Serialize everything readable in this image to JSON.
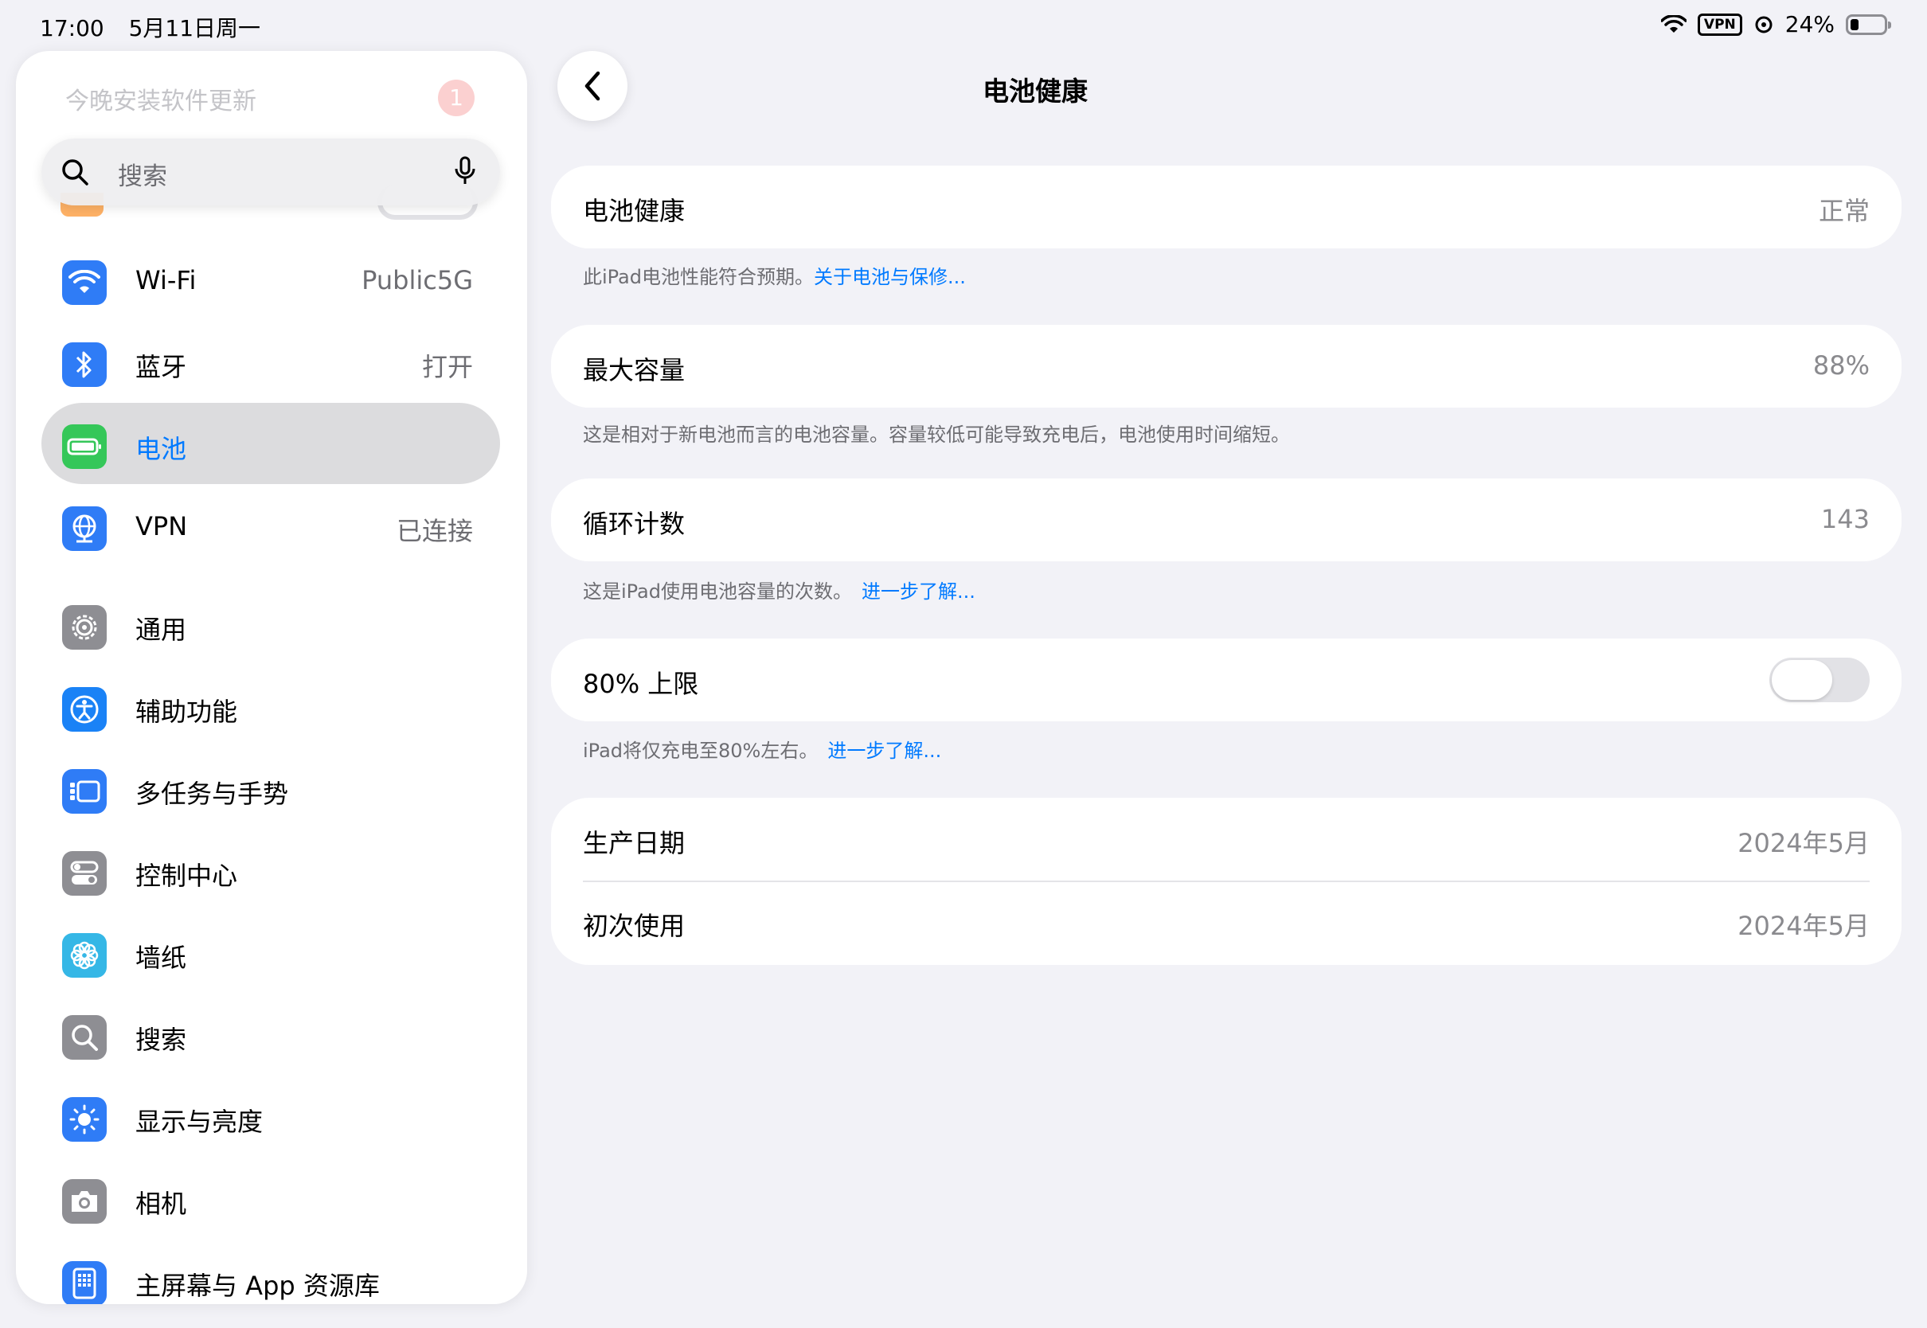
{
  "status_bar": {
    "time": "17:00",
    "date": "5月11日周一",
    "vpn": "VPN",
    "battery_percent": "24%",
    "battery_level": 0.24
  },
  "sidebar": {
    "update_banner": "今晚安装软件更新",
    "update_badge": "1",
    "search_placeholder": "搜索",
    "items": [
      {
        "label": "Wi-Fi",
        "value": "Public5G",
        "icon": "wifi-icon",
        "color": "#2f7cf6"
      },
      {
        "label": "蓝牙",
        "value": "打开",
        "icon": "bluetooth-icon",
        "color": "#2f7cf6"
      },
      {
        "label": "电池",
        "value": "",
        "icon": "battery-icon",
        "color": "#35c759",
        "selected": true
      },
      {
        "label": "VPN",
        "value": "已连接",
        "icon": "globe-icon",
        "color": "#2f7cf6"
      },
      {
        "label": "通用",
        "value": "",
        "icon": "gear-icon",
        "color": "#8e8e93"
      },
      {
        "label": "辅助功能",
        "value": "",
        "icon": "accessibility-icon",
        "color": "#1a82f6"
      },
      {
        "label": "多任务与手势",
        "value": "",
        "icon": "multitasking-icon",
        "color": "#2f7cf6"
      },
      {
        "label": "控制中心",
        "value": "",
        "icon": "switches-icon",
        "color": "#8e8e93"
      },
      {
        "label": "墙纸",
        "value": "",
        "icon": "flower-icon",
        "color": "#35b7e6"
      },
      {
        "label": "搜索",
        "value": "",
        "icon": "magnifier-icon",
        "color": "#8e8e93"
      },
      {
        "label": "显示与亮度",
        "value": "",
        "icon": "sun-icon",
        "color": "#2f7cf6"
      },
      {
        "label": "相机",
        "value": "",
        "icon": "camera-icon",
        "color": "#8e8e93"
      },
      {
        "label": "主屏幕与 App 资源库",
        "value": "",
        "icon": "home-grid-icon",
        "color": "#2f7cf6"
      }
    ]
  },
  "main": {
    "title": "电池健康",
    "battery_health": {
      "label": "电池健康",
      "value": "正常"
    },
    "battery_health_note": "此iPad电池性能符合预期。",
    "battery_health_link": "关于电池与保修...",
    "max_capacity": {
      "label": "最大容量",
      "value": "88%"
    },
    "max_capacity_note": "这是相对于新电池而言的电池容量。容量较低可能导致充电后，电池使用时间缩短。",
    "cycle_count": {
      "label": "循环计数",
      "value": "143"
    },
    "cycle_note": "这是iPad使用电池容量的次数。",
    "cycle_link": "进一步了解...",
    "limit_80": {
      "label": "80% 上限",
      "enabled": false
    },
    "limit_note": "iPad将仅充电至80%左右。",
    "limit_link": "进一步了解...",
    "manufacture_date": {
      "label": "生产日期",
      "value": "2024年5月"
    },
    "first_use": {
      "label": "初次使用",
      "value": "2024年5月"
    }
  }
}
